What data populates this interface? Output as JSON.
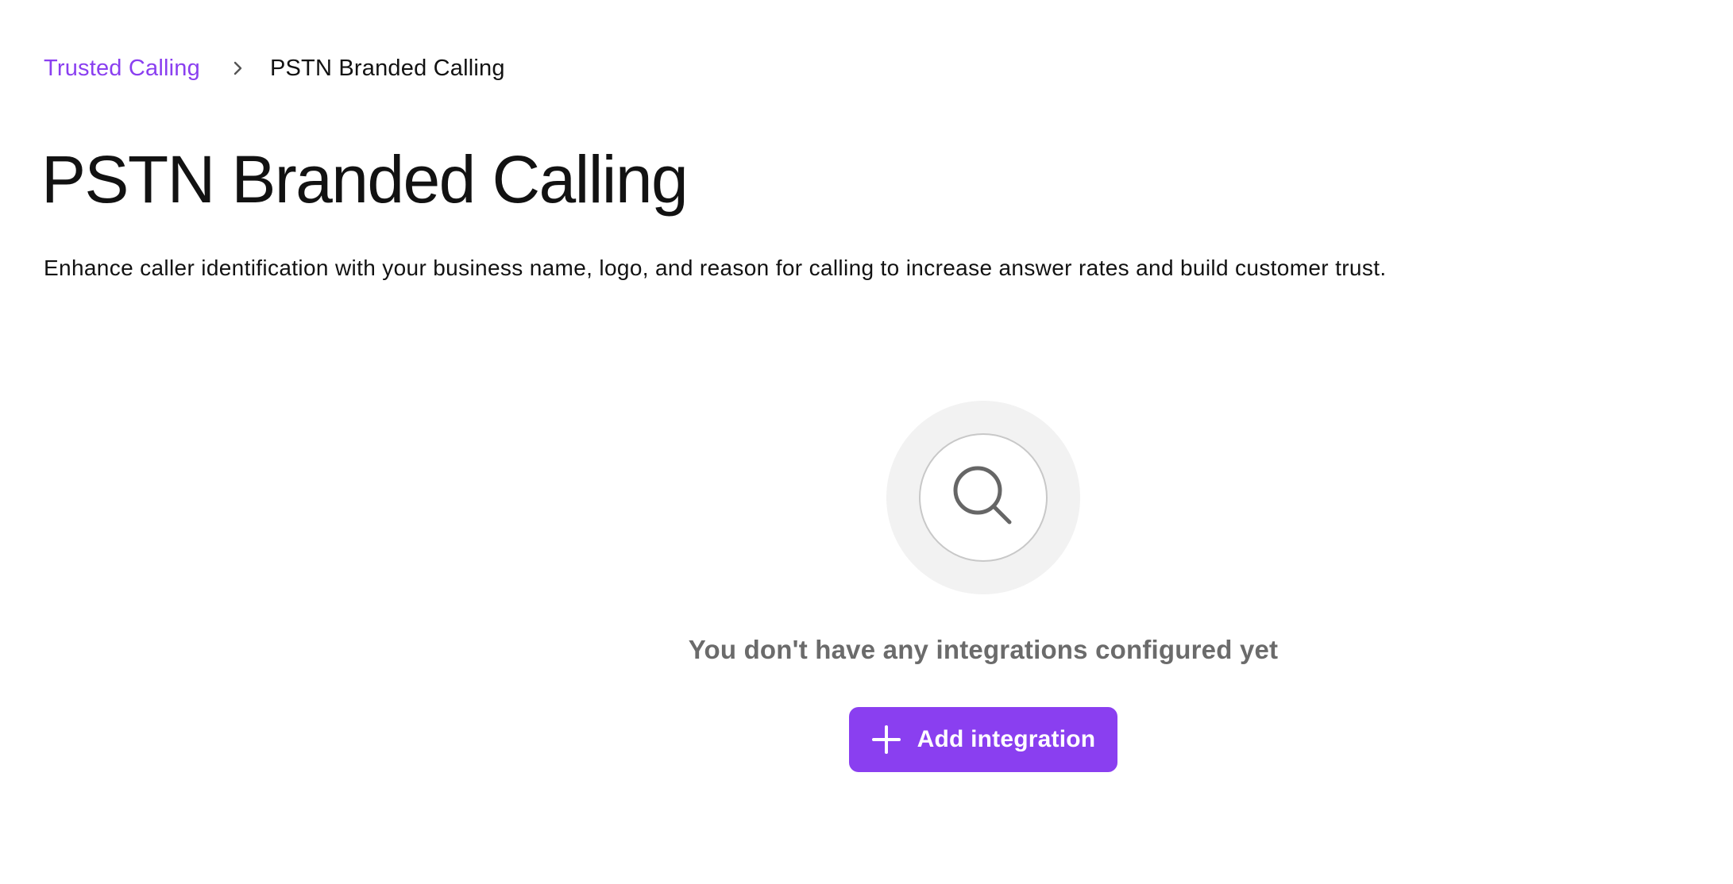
{
  "breadcrumb": {
    "parent_label": "Trusted Calling",
    "separator_icon": "chevron-right-icon",
    "current_label": "PSTN Branded Calling"
  },
  "page": {
    "title": "PSTN Branded Calling",
    "description": "Enhance caller identification with your business name, logo, and reason for calling to increase answer rates and build customer trust."
  },
  "empty_state": {
    "icon": "search-icon",
    "message": "You don't have any integrations configured yet",
    "button_label": "Add integration",
    "button_icon": "plus-icon"
  },
  "colors": {
    "accent": "#8a3ff0",
    "text": "#121212",
    "muted": "#6b6b6b",
    "illustration_bg": "#f2f2f2"
  }
}
